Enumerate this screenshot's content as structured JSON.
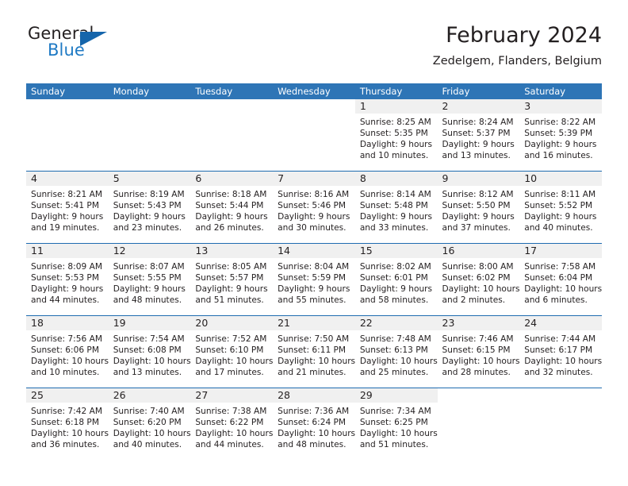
{
  "brand": {
    "word_general": "General",
    "word_blue": "Blue",
    "logo_icon": "triangle-flag-icon",
    "accent_color": "#1f7ac4"
  },
  "header": {
    "title": "February 2024",
    "subtitle": "Zedelgem, Flanders, Belgium"
  },
  "calendar": {
    "header_color": "#2e75b6",
    "row_divider_color": "#1f6cb0",
    "daynum_band_color": "#f0f0f0",
    "weekday_headers": [
      "Sunday",
      "Monday",
      "Tuesday",
      "Wednesday",
      "Thursday",
      "Friday",
      "Saturday"
    ],
    "weeks": [
      [
        {
          "day": "",
          "blank": true,
          "lines": []
        },
        {
          "day": "",
          "blank": true,
          "lines": []
        },
        {
          "day": "",
          "blank": true,
          "lines": []
        },
        {
          "day": "",
          "blank": true,
          "lines": []
        },
        {
          "day": "1",
          "lines": [
            "Sunrise: 8:25 AM",
            "Sunset: 5:35 PM",
            "Daylight: 9 hours",
            "and 10 minutes."
          ]
        },
        {
          "day": "2",
          "lines": [
            "Sunrise: 8:24 AM",
            "Sunset: 5:37 PM",
            "Daylight: 9 hours",
            "and 13 minutes."
          ]
        },
        {
          "day": "3",
          "lines": [
            "Sunrise: 8:22 AM",
            "Sunset: 5:39 PM",
            "Daylight: 9 hours",
            "and 16 minutes."
          ]
        }
      ],
      [
        {
          "day": "4",
          "lines": [
            "Sunrise: 8:21 AM",
            "Sunset: 5:41 PM",
            "Daylight: 9 hours",
            "and 19 minutes."
          ]
        },
        {
          "day": "5",
          "lines": [
            "Sunrise: 8:19 AM",
            "Sunset: 5:43 PM",
            "Daylight: 9 hours",
            "and 23 minutes."
          ]
        },
        {
          "day": "6",
          "lines": [
            "Sunrise: 8:18 AM",
            "Sunset: 5:44 PM",
            "Daylight: 9 hours",
            "and 26 minutes."
          ]
        },
        {
          "day": "7",
          "lines": [
            "Sunrise: 8:16 AM",
            "Sunset: 5:46 PM",
            "Daylight: 9 hours",
            "and 30 minutes."
          ]
        },
        {
          "day": "8",
          "lines": [
            "Sunrise: 8:14 AM",
            "Sunset: 5:48 PM",
            "Daylight: 9 hours",
            "and 33 minutes."
          ]
        },
        {
          "day": "9",
          "lines": [
            "Sunrise: 8:12 AM",
            "Sunset: 5:50 PM",
            "Daylight: 9 hours",
            "and 37 minutes."
          ]
        },
        {
          "day": "10",
          "lines": [
            "Sunrise: 8:11 AM",
            "Sunset: 5:52 PM",
            "Daylight: 9 hours",
            "and 40 minutes."
          ]
        }
      ],
      [
        {
          "day": "11",
          "lines": [
            "Sunrise: 8:09 AM",
            "Sunset: 5:53 PM",
            "Daylight: 9 hours",
            "and 44 minutes."
          ]
        },
        {
          "day": "12",
          "lines": [
            "Sunrise: 8:07 AM",
            "Sunset: 5:55 PM",
            "Daylight: 9 hours",
            "and 48 minutes."
          ]
        },
        {
          "day": "13",
          "lines": [
            "Sunrise: 8:05 AM",
            "Sunset: 5:57 PM",
            "Daylight: 9 hours",
            "and 51 minutes."
          ]
        },
        {
          "day": "14",
          "lines": [
            "Sunrise: 8:04 AM",
            "Sunset: 5:59 PM",
            "Daylight: 9 hours",
            "and 55 minutes."
          ]
        },
        {
          "day": "15",
          "lines": [
            "Sunrise: 8:02 AM",
            "Sunset: 6:01 PM",
            "Daylight: 9 hours",
            "and 58 minutes."
          ]
        },
        {
          "day": "16",
          "lines": [
            "Sunrise: 8:00 AM",
            "Sunset: 6:02 PM",
            "Daylight: 10 hours",
            "and 2 minutes."
          ]
        },
        {
          "day": "17",
          "lines": [
            "Sunrise: 7:58 AM",
            "Sunset: 6:04 PM",
            "Daylight: 10 hours",
            "and 6 minutes."
          ]
        }
      ],
      [
        {
          "day": "18",
          "lines": [
            "Sunrise: 7:56 AM",
            "Sunset: 6:06 PM",
            "Daylight: 10 hours",
            "and 10 minutes."
          ]
        },
        {
          "day": "19",
          "lines": [
            "Sunrise: 7:54 AM",
            "Sunset: 6:08 PM",
            "Daylight: 10 hours",
            "and 13 minutes."
          ]
        },
        {
          "day": "20",
          "lines": [
            "Sunrise: 7:52 AM",
            "Sunset: 6:10 PM",
            "Daylight: 10 hours",
            "and 17 minutes."
          ]
        },
        {
          "day": "21",
          "lines": [
            "Sunrise: 7:50 AM",
            "Sunset: 6:11 PM",
            "Daylight: 10 hours",
            "and 21 minutes."
          ]
        },
        {
          "day": "22",
          "lines": [
            "Sunrise: 7:48 AM",
            "Sunset: 6:13 PM",
            "Daylight: 10 hours",
            "and 25 minutes."
          ]
        },
        {
          "day": "23",
          "lines": [
            "Sunrise: 7:46 AM",
            "Sunset: 6:15 PM",
            "Daylight: 10 hours",
            "and 28 minutes."
          ]
        },
        {
          "day": "24",
          "lines": [
            "Sunrise: 7:44 AM",
            "Sunset: 6:17 PM",
            "Daylight: 10 hours",
            "and 32 minutes."
          ]
        }
      ],
      [
        {
          "day": "25",
          "lines": [
            "Sunrise: 7:42 AM",
            "Sunset: 6:18 PM",
            "Daylight: 10 hours",
            "and 36 minutes."
          ]
        },
        {
          "day": "26",
          "lines": [
            "Sunrise: 7:40 AM",
            "Sunset: 6:20 PM",
            "Daylight: 10 hours",
            "and 40 minutes."
          ]
        },
        {
          "day": "27",
          "lines": [
            "Sunrise: 7:38 AM",
            "Sunset: 6:22 PM",
            "Daylight: 10 hours",
            "and 44 minutes."
          ]
        },
        {
          "day": "28",
          "lines": [
            "Sunrise: 7:36 AM",
            "Sunset: 6:24 PM",
            "Daylight: 10 hours",
            "and 48 minutes."
          ]
        },
        {
          "day": "29",
          "lines": [
            "Sunrise: 7:34 AM",
            "Sunset: 6:25 PM",
            "Daylight: 10 hours",
            "and 51 minutes."
          ]
        },
        {
          "day": "",
          "blank": true,
          "lines": []
        },
        {
          "day": "",
          "blank": true,
          "lines": []
        }
      ]
    ]
  }
}
